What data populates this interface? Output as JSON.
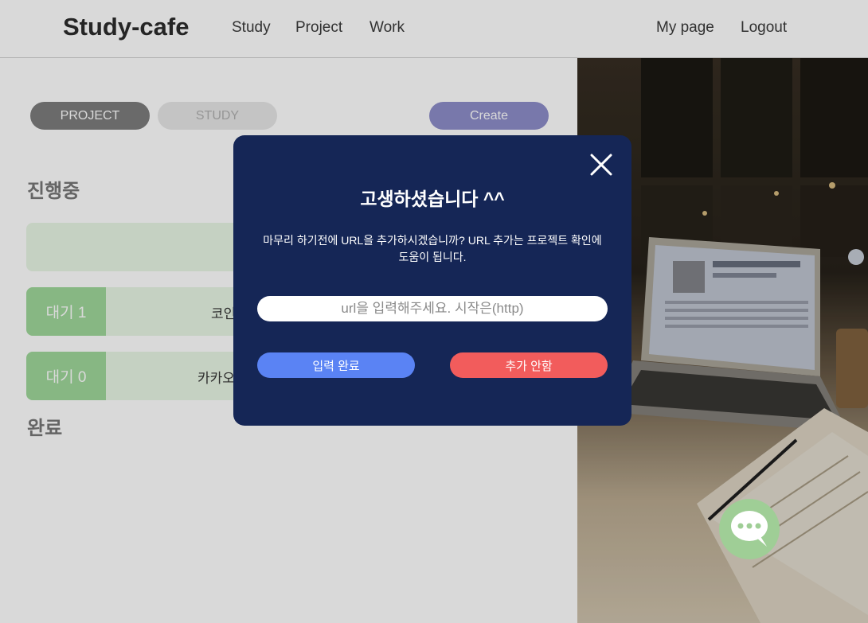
{
  "nav": {
    "brand": "Study-cafe",
    "links": [
      "Study",
      "Project",
      "Work"
    ],
    "right_links": [
      "My page",
      "Logout"
    ]
  },
  "toolbar": {
    "project_tab": "PROJECT",
    "study_tab": "STUDY",
    "create_label": "Create"
  },
  "sections": {
    "in_progress": "진행중",
    "done": "완료"
  },
  "cards": [
    {
      "tag": "",
      "title": ""
    },
    {
      "tag": "대기 1",
      "title": "코인"
    },
    {
      "tag": "대기 0",
      "title": "카카오"
    }
  ],
  "modal": {
    "title": "고생하셨습니다 ^^",
    "message": "마무리 하기전에 URL을 추가하시겠습니까? URL 추가는 프로젝트 확인에 도움이 됩니다.",
    "url_placeholder": "url을 입력해주세요. 시작은(http)",
    "url_value": "",
    "confirm_label": "입력 완료",
    "skip_label": "추가 안함"
  },
  "colors": {
    "modal_bg": "#152656",
    "confirm": "#5a83f4",
    "skip": "#f25c5c",
    "create": "#8e8dc9",
    "card_tag": "#9fd79a",
    "chat": "#9fce96"
  },
  "icons": {
    "close": "close-icon",
    "chat": "chat-bubble-icon"
  }
}
